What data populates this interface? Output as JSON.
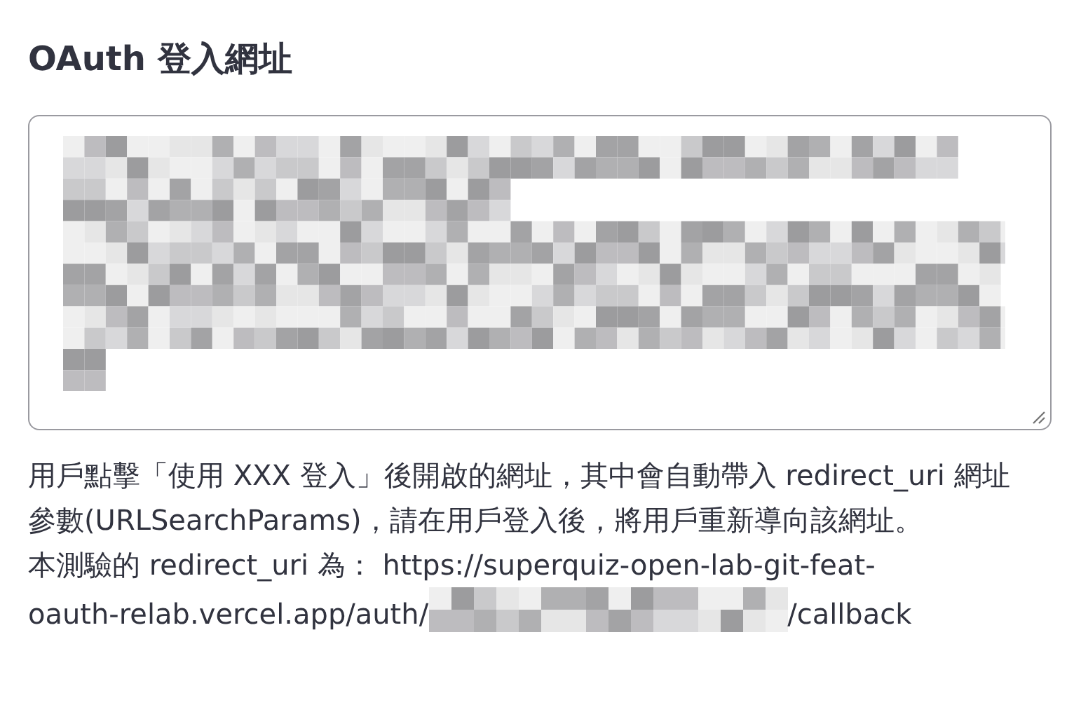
{
  "title": "OAuth 登入網址",
  "textarea": {
    "resizable": true
  },
  "help": "用戶點擊「使用 XXX 登入」後開啟的網址，其中會自動帶入 redirect_uri 網址參數(URLSearchParams)，請在用戶登入後，將用戶重新導向該網址。",
  "redirect": {
    "label": "本測驗的 redirect_uri 為：",
    "url_parts": [
      "https://superquiz-open-lab-git-feat-",
      "oauth-relab.vercel.app/auth/"
    ],
    "url_end": "/callback"
  }
}
